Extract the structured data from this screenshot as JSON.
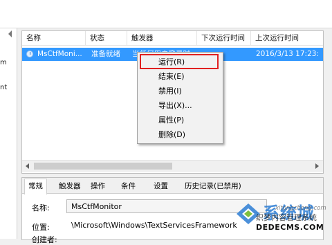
{
  "left_pane": {
    "fragments": [
      "m",
      "nt"
    ]
  },
  "task_list": {
    "columns": [
      "名称",
      "状态",
      "触发器",
      "下次运行时间",
      "上次运行时间"
    ],
    "rows": [
      {
        "name": "MsCtfMoni...",
        "status": "准备就绪",
        "trigger": "当任何用户登录时",
        "next_run": "",
        "last_run": "2016/3/13 17:23:"
      }
    ]
  },
  "context_menu": {
    "items": [
      "运行(R)",
      "结束(E)",
      "禁用(I)",
      "导出(X)...",
      "属性(P)",
      "删除(D)"
    ],
    "highlighted_index": 0
  },
  "colors": {
    "selection": "#3399ff",
    "highlight_box": "#e02020",
    "watermark_blue": "#2b7cd3"
  },
  "detail": {
    "tabs": [
      "常规",
      "触发器",
      "操作",
      "条件",
      "设置",
      "历史记录(已禁用)"
    ],
    "active_tab": "常规",
    "name_label": "名称:",
    "name_value": "MsCtfMonitor",
    "location_label": "位置:",
    "location_value": "\\Microsoft\\Windows\\TextServicesFramework",
    "author_label": "创建者:"
  },
  "watermark": {
    "brand": "系统城",
    "site": "xitongcheng.com",
    "tagline": "织梦内容管理系统",
    "domain": "DEDECMS.COM"
  }
}
